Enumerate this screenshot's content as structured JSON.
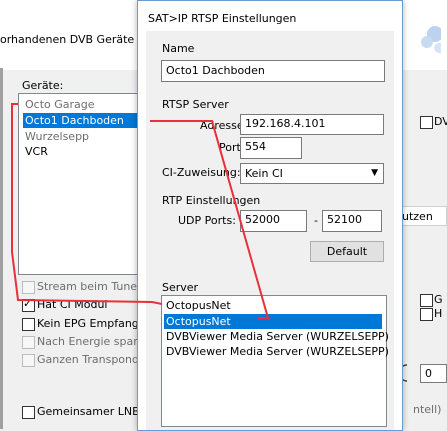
{
  "background": {
    "title_fragment": "orhandenen DVB Geräte verv",
    "devices_label": "Geräte:",
    "devices": [
      {
        "label": "Octo Garage",
        "state": "grey"
      },
      {
        "label": "Octo1 Dachboden",
        "state": "selected"
      },
      {
        "label": "Wurzelsepp",
        "state": "grey"
      },
      {
        "label": "VCR",
        "state": "normal"
      }
    ],
    "checkboxes": [
      {
        "label": "Stream beim Tunen",
        "checked": false,
        "disabled": true
      },
      {
        "label": "Hat CI Modul",
        "checked": true,
        "disabled": false
      },
      {
        "label": "Kein EPG Empfang",
        "checked": false,
        "disabled": false
      },
      {
        "label": "Nach Energie sparen",
        "checked": false,
        "disabled": true
      },
      {
        "label": "Ganzen Transponder",
        "checked": false,
        "disabled": true
      },
      {
        "label": "Gemeinsamer LNB",
        "checked": false,
        "disabled": false
      }
    ],
    "right_fragments": {
      "dv": "DV",
      "utzen": "utzen",
      "g": "G",
      "h": "H",
      "zero": "0",
      "ntell": "ntell)"
    }
  },
  "dialog": {
    "title": "SAT>IP RTSP Einstellungen",
    "name_label": "Name",
    "name_value": "Octo1 Dachboden",
    "rtsp_label": "RTSP Server",
    "adresse_label": "Adresse:",
    "adresse_value": "192.168.4.101",
    "port_label": "Port:",
    "port_value": "554",
    "ci_label": "CI-Zuweisung:",
    "ci_value": "Kein CI",
    "rtp_label": "RTP Einstellungen",
    "udp_label": "UDP Ports:",
    "udp_from": "52000",
    "udp_sep": "-",
    "udp_to": "52100",
    "default_button": "Default",
    "server_label": "Server",
    "servers": [
      {
        "label": "OctopusNet",
        "selected": false
      },
      {
        "label": "OctopusNet",
        "selected": true
      },
      {
        "label": "DVBViewer Media Server (WURZELSEPP)",
        "selected": false
      },
      {
        "label": "DVBViewer Media Server (WURZELSEPP)",
        "selected": false
      }
    ]
  },
  "colors": {
    "selection": "#0078d7",
    "annotation": "#e8303a"
  }
}
